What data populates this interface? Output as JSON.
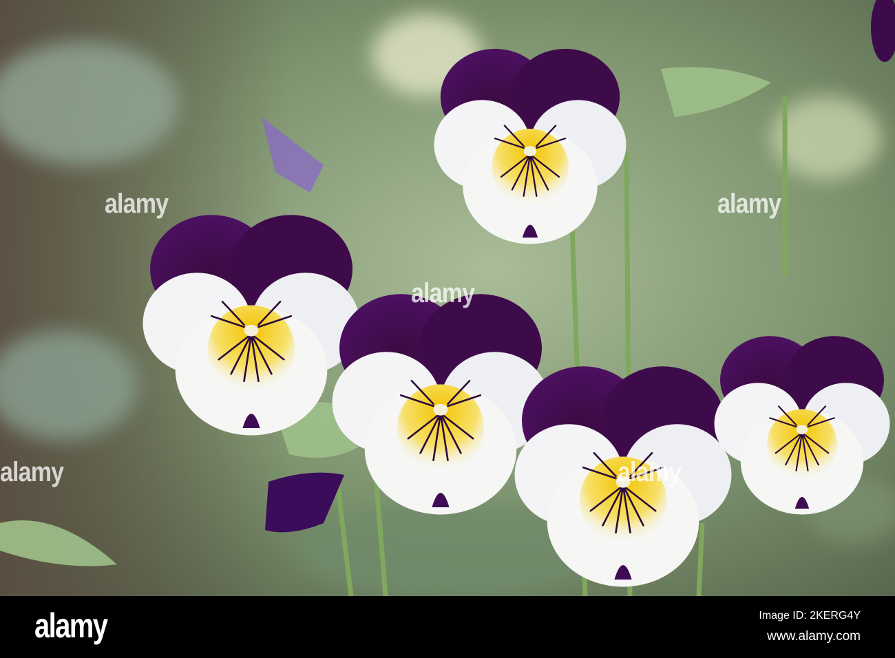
{
  "watermark": "alamy",
  "footer": {
    "logo": "alamy",
    "image_id": "Image ID: 2KERG4Y",
    "website": "www.alamy.com"
  }
}
